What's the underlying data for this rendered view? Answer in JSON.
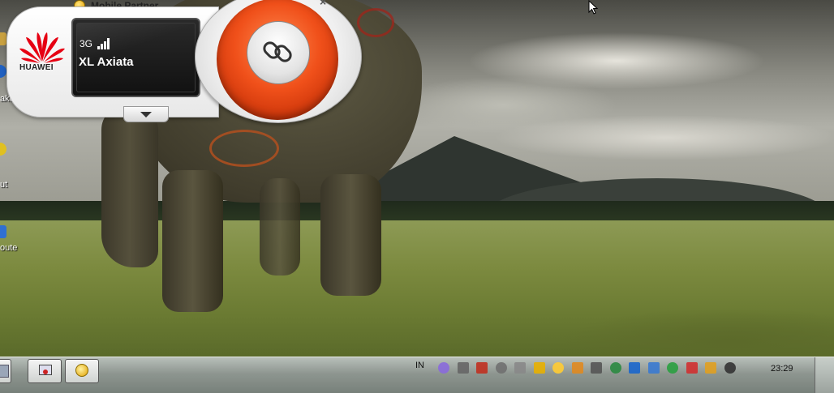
{
  "widget": {
    "title": "Mobile Partner",
    "brand": "HUAWEI",
    "network_type": "3G",
    "operator": "XL Axiata",
    "signal_bars": 4,
    "connect_icon": "link-icon",
    "expand_icon": "chevron-down-icon",
    "close_label": "×",
    "accent_color": "#e8501e"
  },
  "desktop": {
    "icon_labels": [
      "aker",
      "ut",
      "oute"
    ]
  },
  "taskbar": {
    "language": "IN",
    "clock": "23:29",
    "tray_icons": [
      {
        "name": "feather-icon",
        "color": "#8a6adc"
      },
      {
        "name": "keyboard-icon",
        "color": "#666666"
      },
      {
        "name": "wifi-router-icon",
        "color": "#c03020"
      },
      {
        "name": "tools-icon",
        "color": "#707070"
      },
      {
        "name": "window-icon",
        "color": "#888888"
      },
      {
        "name": "mobile-partner-icon",
        "color": "#e8b000"
      },
      {
        "name": "yahoo-messenger-icon",
        "color": "#ffcc33"
      },
      {
        "name": "package-icon",
        "color": "#e08a20"
      },
      {
        "name": "signal-icon",
        "color": "#555555"
      },
      {
        "name": "globe-icon",
        "color": "#2a8a40"
      },
      {
        "name": "arrow-icon",
        "color": "#1a66cc"
      },
      {
        "name": "shield-icon",
        "color": "#3a7ad0"
      },
      {
        "name": "flag-check-icon",
        "color": "#2aa040"
      },
      {
        "name": "flag-x-icon",
        "color": "#d03030"
      },
      {
        "name": "burst-icon",
        "color": "#e0a020"
      },
      {
        "name": "volume-icon",
        "color": "#333333"
      }
    ]
  }
}
